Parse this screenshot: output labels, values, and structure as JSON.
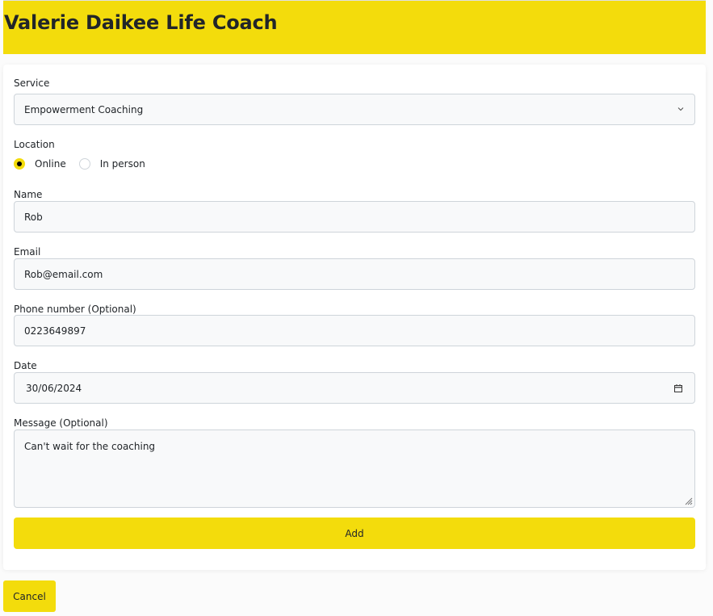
{
  "header": {
    "title": "Valerie Daikee Life Coach"
  },
  "form": {
    "service": {
      "label": "Service",
      "value": "Empowerment Coaching"
    },
    "location": {
      "label": "Location",
      "options": [
        {
          "label": "Online",
          "checked": true
        },
        {
          "label": "In person",
          "checked": false
        }
      ]
    },
    "name": {
      "label": "Name",
      "value": "Rob"
    },
    "email": {
      "label": "Email",
      "value": "Rob@email.com"
    },
    "phone": {
      "label": "Phone number (Optional)",
      "value": "0223649897"
    },
    "date": {
      "label": "Date",
      "value": "30/06/2024"
    },
    "message": {
      "label": "Message (Optional)",
      "value": "Can't wait for the coaching"
    },
    "add_label": "Add"
  },
  "cancel_label": "Cancel",
  "colors": {
    "accent": "#f3dc0c",
    "field_bg": "#f8f9fa",
    "border": "#ced4da"
  },
  "icons": {
    "select": "chevron-down-icon",
    "date": "calendar-icon",
    "textarea": "resize-grip-icon"
  }
}
